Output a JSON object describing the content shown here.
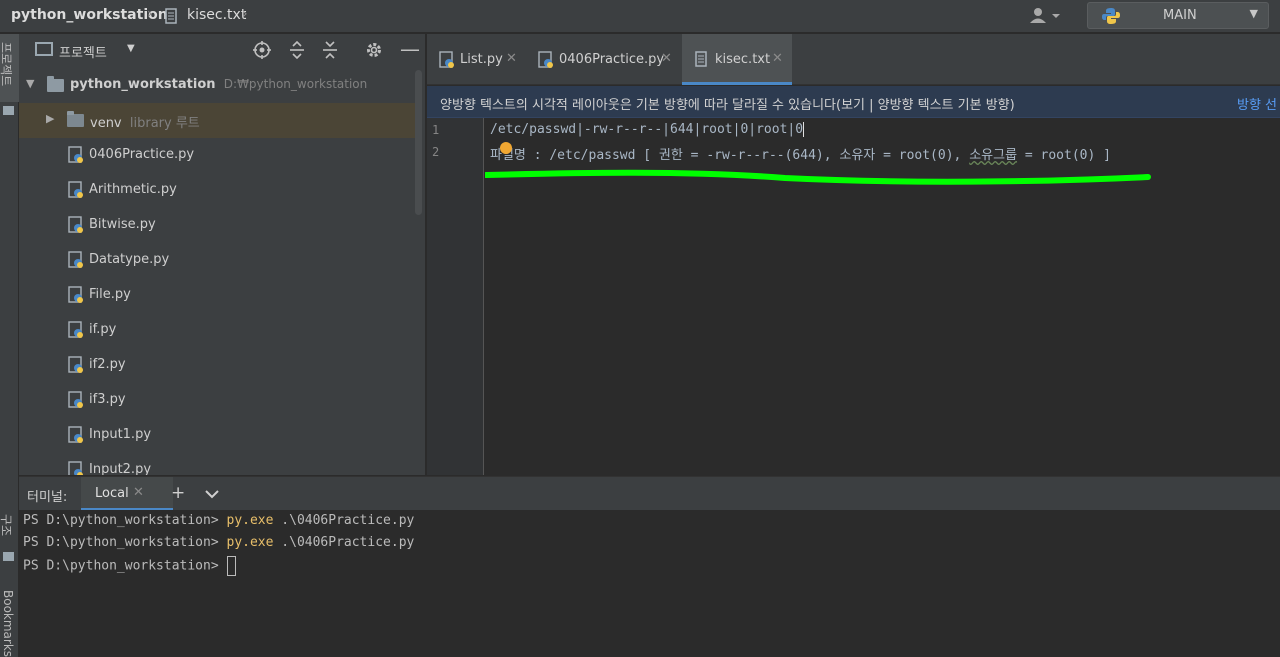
{
  "topbar": {
    "project": "python_workstation",
    "file": "kisec.txt",
    "run_config": "MAIN"
  },
  "side": {
    "project_label": "프로젝트",
    "structure_label": "구조",
    "bookmarks_label": "Bookmarks"
  },
  "project_panel": {
    "title": "프로젝트",
    "root": {
      "name": "python_workstation",
      "path": "D:₩python_workstation"
    },
    "venv": {
      "name": "venv",
      "sub": "library 루트"
    },
    "files": [
      "0406Practice.py",
      "Arithmetic.py",
      "Bitwise.py",
      "Datatype.py",
      "File.py",
      "if.py",
      "if2.py",
      "if3.py",
      "Input1.py",
      "Input2.py"
    ]
  },
  "tabs": [
    {
      "label": "List.py"
    },
    {
      "label": "0406Practice.py"
    },
    {
      "label": "kisec.txt"
    }
  ],
  "banner": {
    "text": "양방향 텍스트의 시각적 레이아웃은 기본 방향에 따라 달라질 수 있습니다(보기 | 양방향 텍스트 기본 방향)",
    "link": "방향 선"
  },
  "editor": {
    "lines": [
      {
        "no": "1",
        "text": "/etc/passwd|-rw-r--r--|644|root|0|root|0"
      },
      {
        "no": "2",
        "prefix": "파일명 : /etc/passwd [ 권한 = -rw-r--r--(644), 소유자 = root(0), ",
        "squiggle": "소유그룹",
        "suffix": " = root(0) ]"
      }
    ],
    "highlight_color": "#00ff00"
  },
  "terminal": {
    "title": "터미널:",
    "tab": "Local",
    "lines": [
      {
        "prompt": "PS D:\\python_workstation> ",
        "cmd": "py.exe",
        "args": " .\\0406Practice.py"
      },
      {
        "prompt": "PS D:\\python_workstation> ",
        "cmd": "py.exe",
        "args": " .\\0406Practice.py"
      },
      {
        "prompt": "PS D:\\python_workstation> ",
        "cmd": "",
        "args": ""
      }
    ]
  }
}
